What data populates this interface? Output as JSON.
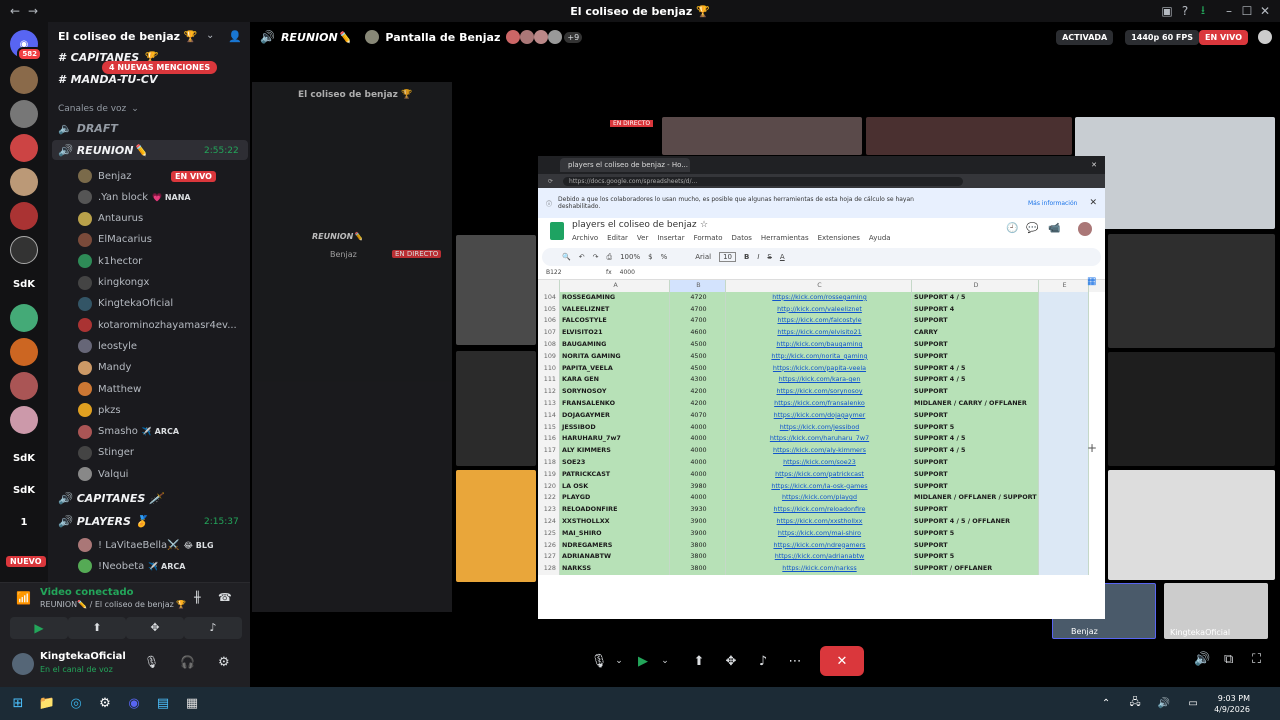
{
  "window_title": "El coliseo de benjaz 🏆",
  "server": {
    "name": "El coliseo de benjaz 🏆",
    "mentions": "4 NUEVAS MENCIONES"
  },
  "channels": {
    "capitanes_top": "CAPITANES 🏆",
    "manda": "MANDA-TU-CV",
    "voice_header": "Canales de voz",
    "draft": "DRAFT",
    "reunion": "REUNION✏️",
    "reunion_time": "2:55:22",
    "capitanes": "CAPITANES 🗡️",
    "players": "PLAYERS 🏅",
    "players_time": "2:15:37"
  },
  "reunion_users": [
    {
      "name": "Benjaz",
      "color": "#7a6a4a",
      "extra": "EN VIVO"
    },
    {
      "name": ".Yan block",
      "color": "#555",
      "extra": "💗 NANA"
    },
    {
      "name": "Antaurus",
      "color": "#b9a14a",
      "extra": ""
    },
    {
      "name": "ElMacarius",
      "color": "#7a4a3a",
      "extra": ""
    },
    {
      "name": "k1hector",
      "color": "#2e8b57",
      "extra": ""
    },
    {
      "name": "kingkongx",
      "color": "#444",
      "extra": ""
    },
    {
      "name": "KingtekaOficial",
      "color": "#356",
      "extra": ""
    },
    {
      "name": "kotarominozhayamasr4ev...",
      "color": "#a33",
      "extra": ""
    },
    {
      "name": "leostyle",
      "color": "#667",
      "extra": ""
    },
    {
      "name": "Mandy",
      "color": "#c96",
      "extra": ""
    },
    {
      "name": "Matthew",
      "color": "#c73",
      "extra": ""
    },
    {
      "name": "pkzs",
      "color": "#e0a020",
      "extra": ""
    },
    {
      "name": "Smasho",
      "color": "#a55",
      "extra": "✈️ ARCA"
    },
    {
      "name": "Stinger",
      "color": "#444",
      "extra": ""
    },
    {
      "name": "Valqui",
      "color": "#888",
      "extra": ""
    }
  ],
  "players_users": [
    {
      "name": "! LaVitaeBella⚔️",
      "color": "#a77",
      "extra": "😂 BLG"
    },
    {
      "name": "!Neobeta",
      "color": "#5a5",
      "extra": "✈️ ARCA"
    }
  ],
  "rail": {
    "top_badge": "582",
    "nuevo": "NUEVO",
    "labels": [
      "SdK",
      "SdK",
      "SdK",
      "1"
    ]
  },
  "voice_panel": {
    "status": "Video conectado",
    "location": "REUNION✏️ / El coliseo de benjaz 🏆",
    "user": "KingtekaOficial",
    "user_status": "En el canal de voz"
  },
  "stage": {
    "channel": "REUNION✏️",
    "screen_label": "Pantalla de Benjaz",
    "extra_count": "+9",
    "activated": "ACTIVADA",
    "quality": "1440p 60 FPS",
    "live": "EN VIVO"
  },
  "docs": {
    "tab_title": "players el coliseo de benjaz - Ho...",
    "url": "https://docs.google.com/spreadsheets/d/...",
    "banner": "Debido a que los colaboradores lo usan mucho, es posible que algunas herramientas de esta hoja de cálculo se hayan deshabilitado.",
    "banner_link": "Más información",
    "doc_title": "players el coliseo de benjaz",
    "menus": [
      "Archivo",
      "Editar",
      "Ver",
      "Insertar",
      "Formato",
      "Datos",
      "Herramientas",
      "Extensiones",
      "Ayuda"
    ],
    "zoom": "100%",
    "font": "Arial",
    "font_size": "10",
    "cellref": "B122",
    "formula": "4000",
    "col_headers": [
      "A",
      "B",
      "C",
      "D",
      "E"
    ]
  },
  "sheet_rows": [
    {
      "n": "104",
      "name": "ROSSEGAMING",
      "pts": "4720",
      "link": "https://kick.com/rossegaming",
      "role": "SUPPORT 4 / 5"
    },
    {
      "n": "105",
      "name": "VALEELIZNET",
      "pts": "4700",
      "link": "http://kick.com/valeeliznet",
      "role": "SUPPORT 4"
    },
    {
      "n": "106",
      "name": "FALCOSTYLE",
      "pts": "4700",
      "link": "https://kick.com/falcostyle",
      "role": "SUPPORT"
    },
    {
      "n": "107",
      "name": "ELVISITO21",
      "pts": "4600",
      "link": "https://kick.com/elvisito21",
      "role": "CARRY"
    },
    {
      "n": "108",
      "name": "BAUGAMING",
      "pts": "4500",
      "link": "http://kick.com/baugaming",
      "role": "SUPPORT"
    },
    {
      "n": "109",
      "name": "NORITA GAMING",
      "pts": "4500",
      "link": "http://kick.com/norita_gaming",
      "role": "SUPPORT"
    },
    {
      "n": "110",
      "name": "PAPITA_VEELA",
      "pts": "4500",
      "link": "https://kick.com/papita-veela",
      "role": "SUPPORT 4 / 5"
    },
    {
      "n": "111",
      "name": "KARA GEN",
      "pts": "4300",
      "link": "https://kick.com/kara-gen",
      "role": "SUPPORT 4 / 5"
    },
    {
      "n": "112",
      "name": "SORYNOSOY",
      "pts": "4200",
      "link": "https://kick.com/sorynosoy",
      "role": "SUPPORT"
    },
    {
      "n": "113",
      "name": "FRANSALENKO",
      "pts": "4200",
      "link": "https://kick.com/fransalenko",
      "role": "MIDLANER / CARRY / OFFLANER"
    },
    {
      "n": "114",
      "name": "DOJAGAYMER",
      "pts": "4070",
      "link": "https://kick.com/dojagaymer",
      "role": "SUPPORT"
    },
    {
      "n": "115",
      "name": "JESSIBOD",
      "pts": "4000",
      "link": "https://kick.com/jessibod",
      "role": "SUPPORT 5"
    },
    {
      "n": "116",
      "name": "HARUHARU_7w7",
      "pts": "4000",
      "link": "https://kick.com/haruharu_7w7",
      "role": "SUPPORT 4 / 5"
    },
    {
      "n": "117",
      "name": "ALY KIMMERS",
      "pts": "4000",
      "link": "https://kick.com/aly-kimmers",
      "role": "SUPPORT 4 / 5"
    },
    {
      "n": "118",
      "name": "SOE23",
      "pts": "4000",
      "link": "https://kick.com/soe23",
      "role": "SUPPORT"
    },
    {
      "n": "119",
      "name": "PATRICKCAST",
      "pts": "4000",
      "link": "https://kick.com/patrickcast",
      "role": "SUPPORT"
    },
    {
      "n": "120",
      "name": "LA OSK",
      "pts": "3980",
      "link": "https://kick.com/la-osk-games",
      "role": "SUPPORT"
    },
    {
      "n": "122",
      "name": "PLAYGD",
      "pts": "4000",
      "link": "https://kick.com/playgd",
      "role": "MIDLANER / OFFLANER / SUPPORT"
    },
    {
      "n": "123",
      "name": "RELOADONFIRE",
      "pts": "3930",
      "link": "https://kick.com/reloadonfire",
      "role": "SUPPORT"
    },
    {
      "n": "124",
      "name": "XXSTHOLLXX",
      "pts": "3900",
      "link": "https://kick.com/xxsthollxx",
      "role": "SUPPORT 4 / 5 / OFFLANER"
    },
    {
      "n": "125",
      "name": "MAI_SHIRO",
      "pts": "3900",
      "link": "https://kick.com/mai-shiro",
      "role": "SUPPORT 5"
    },
    {
      "n": "126",
      "name": "NDREGAMERS",
      "pts": "3800",
      "link": "https://kick.com/ndregamers",
      "role": "SUPPORT"
    },
    {
      "n": "127",
      "name": "ADRIANABTW",
      "pts": "3800",
      "link": "https://kick.com/adrianabtw",
      "role": "SUPPORT 5"
    },
    {
      "n": "128",
      "name": "NARKSS",
      "pts": "3800",
      "link": "https://kick.com/narkss",
      "role": "SUPPORT / OFFLANER"
    }
  ],
  "tiles": {
    "benjaz": "Benjaz",
    "kingteka": "KingtekaOficial",
    "en_directo": "EN DIRECTO"
  },
  "clock": {
    "time": "9:03 PM",
    "date": "4/9/2026"
  },
  "colors": {
    "live": "#da373c",
    "voice_green": "#23a55a",
    "sheet_green": "#b7e1b7",
    "brand": "#5865f2"
  }
}
